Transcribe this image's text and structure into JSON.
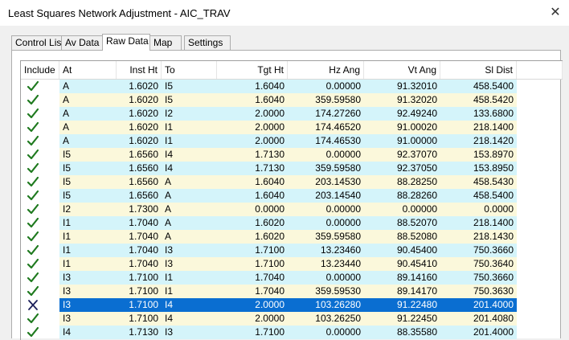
{
  "window": {
    "title": "Least Squares Network Adjustment - AIC_TRAV"
  },
  "tabs": [
    {
      "label": "Control List",
      "active": false
    },
    {
      "label": "Av Data",
      "active": false
    },
    {
      "label": "Raw Data",
      "active": true
    },
    {
      "label": "Map",
      "active": false
    },
    {
      "label": "Settings",
      "active": false
    }
  ],
  "colors": {
    "row_blue": "#d4f4fa",
    "row_yellow": "#fbf8db",
    "selected": "#0a6ed1",
    "check": "#1f7a1f",
    "cross": "#1b1f5a"
  },
  "grid": {
    "headers": [
      "Include",
      "At",
      "Inst Ht",
      "To",
      "Tgt Ht",
      "Hz Ang",
      "Vt Ang",
      "Sl Dist"
    ],
    "rows": [
      {
        "include": true,
        "at": "A",
        "inst_ht": "1.6020",
        "to": "I5",
        "tgt_ht": "1.6040",
        "hz": "0.00000",
        "vt": "91.32010",
        "sl": "458.5400"
      },
      {
        "include": true,
        "at": "A",
        "inst_ht": "1.6020",
        "to": "I5",
        "tgt_ht": "1.6040",
        "hz": "359.59580",
        "vt": "91.32020",
        "sl": "458.5420"
      },
      {
        "include": true,
        "at": "A",
        "inst_ht": "1.6020",
        "to": "I2",
        "tgt_ht": "2.0000",
        "hz": "174.27260",
        "vt": "92.49240",
        "sl": "133.6800"
      },
      {
        "include": true,
        "at": "A",
        "inst_ht": "1.6020",
        "to": "I1",
        "tgt_ht": "2.0000",
        "hz": "174.46520",
        "vt": "91.00020",
        "sl": "218.1400"
      },
      {
        "include": true,
        "at": "A",
        "inst_ht": "1.6020",
        "to": "I1",
        "tgt_ht": "2.0000",
        "hz": "174.46530",
        "vt": "91.00000",
        "sl": "218.1420"
      },
      {
        "include": true,
        "at": "I5",
        "inst_ht": "1.6560",
        "to": "I4",
        "tgt_ht": "1.7130",
        "hz": "0.00000",
        "vt": "92.37070",
        "sl": "153.8970"
      },
      {
        "include": true,
        "at": "I5",
        "inst_ht": "1.6560",
        "to": "I4",
        "tgt_ht": "1.7130",
        "hz": "359.59580",
        "vt": "92.37050",
        "sl": "153.8950"
      },
      {
        "include": true,
        "at": "I5",
        "inst_ht": "1.6560",
        "to": "A",
        "tgt_ht": "1.6040",
        "hz": "203.14530",
        "vt": "88.28250",
        "sl": "458.5430"
      },
      {
        "include": true,
        "at": "I5",
        "inst_ht": "1.6560",
        "to": "A",
        "tgt_ht": "1.6040",
        "hz": "203.14540",
        "vt": "88.28260",
        "sl": "458.5400"
      },
      {
        "include": true,
        "at": "I2",
        "inst_ht": "1.7300",
        "to": "A",
        "tgt_ht": "0.0000",
        "hz": "0.00000",
        "vt": "0.00000",
        "sl": "0.0000"
      },
      {
        "include": true,
        "at": "I1",
        "inst_ht": "1.7040",
        "to": "A",
        "tgt_ht": "1.6020",
        "hz": "0.00000",
        "vt": "88.52070",
        "sl": "218.1400"
      },
      {
        "include": true,
        "at": "I1",
        "inst_ht": "1.7040",
        "to": "A",
        "tgt_ht": "1.6020",
        "hz": "359.59580",
        "vt": "88.52080",
        "sl": "218.1430"
      },
      {
        "include": true,
        "at": "I1",
        "inst_ht": "1.7040",
        "to": "I3",
        "tgt_ht": "1.7100",
        "hz": "13.23460",
        "vt": "90.45400",
        "sl": "750.3660"
      },
      {
        "include": true,
        "at": "I1",
        "inst_ht": "1.7040",
        "to": "I3",
        "tgt_ht": "1.7100",
        "hz": "13.23440",
        "vt": "90.45410",
        "sl": "750.3640"
      },
      {
        "include": true,
        "at": "I3",
        "inst_ht": "1.7100",
        "to": "I1",
        "tgt_ht": "1.7040",
        "hz": "0.00000",
        "vt": "89.14160",
        "sl": "750.3660"
      },
      {
        "include": true,
        "at": "I3",
        "inst_ht": "1.7100",
        "to": "I1",
        "tgt_ht": "1.7040",
        "hz": "359.59530",
        "vt": "89.14170",
        "sl": "750.3630"
      },
      {
        "include": false,
        "selected": true,
        "at": "I3",
        "inst_ht": "1.7100",
        "to": "I4",
        "tgt_ht": "2.0000",
        "hz": "103.26280",
        "vt": "91.22480",
        "sl": "201.4000"
      },
      {
        "include": true,
        "at": "I3",
        "inst_ht": "1.7100",
        "to": "I4",
        "tgt_ht": "2.0000",
        "hz": "103.26250",
        "vt": "91.22450",
        "sl": "201.4080"
      },
      {
        "include": true,
        "at": "I4",
        "inst_ht": "1.7130",
        "to": "I3",
        "tgt_ht": "1.7100",
        "hz": "0.00000",
        "vt": "88.35580",
        "sl": "201.4000"
      }
    ]
  }
}
